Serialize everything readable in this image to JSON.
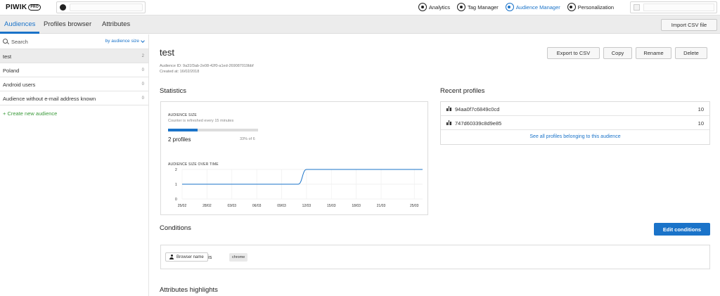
{
  "topbar": {
    "logo_text": "PIWIK",
    "logo_badge": "PRO",
    "modules": [
      {
        "label": "Analytics",
        "icon": "analytics-icon",
        "active": false
      },
      {
        "label": "Tag Manager",
        "icon": "tag-manager-icon",
        "active": false
      },
      {
        "label": "Audience Manager",
        "icon": "audience-manager-icon",
        "active": true
      },
      {
        "label": "Personalization",
        "icon": "personalization-icon",
        "active": false
      }
    ]
  },
  "subnav": {
    "tabs": [
      "Audiences",
      "Profiles browser",
      "Attributes"
    ],
    "active_tab": "Audiences",
    "import_label": "Import CSV file"
  },
  "sidebar": {
    "search_placeholder": "Search",
    "sort_label": "by audience size",
    "audiences": [
      {
        "name": "test",
        "count": "2",
        "selected": true
      },
      {
        "name": "Poland",
        "count": "0",
        "selected": false
      },
      {
        "name": "Android users",
        "count": "0",
        "selected": false
      },
      {
        "name": "Audience without e-mail address known",
        "count": "0",
        "selected": false
      }
    ],
    "create_label": "+ Create new audience"
  },
  "audience": {
    "title": "test",
    "id_line": "Audience ID: 9a31f3ab-2e08-42f0-a1ed-269087019bbf",
    "created_line": "Created at: 16/02/2018",
    "actions": [
      "Export to CSV",
      "Copy",
      "Rename",
      "Delete"
    ]
  },
  "statistics": {
    "title": "Statistics",
    "size_label": "AUDIENCE SIZE",
    "refresh_note": "Counter is refreshed every 15 minutes",
    "progress_fraction": 0.33,
    "profiles_text": "2 profiles",
    "percent_text": "33% of 6",
    "over_time_label": "AUDIENCE SIZE OVER TIME"
  },
  "chart_data": {
    "type": "line",
    "title": "AUDIENCE SIZE OVER TIME",
    "xlabel": "",
    "ylabel": "",
    "x": [
      "25/02",
      "26/02",
      "27/02",
      "28/02",
      "01/03",
      "02/03",
      "03/03",
      "04/03",
      "05/03",
      "06/03",
      "07/03",
      "08/03",
      "09/03",
      "10/03",
      "11/03",
      "12/03",
      "13/03",
      "14/03",
      "15/03",
      "16/03",
      "17/03",
      "18/03",
      "19/03",
      "20/03",
      "21/03",
      "22/03",
      "23/03",
      "24/03",
      "25/03",
      "26/03"
    ],
    "series": [
      {
        "values": [
          1,
          1,
          1,
          1,
          1,
          1,
          1,
          1,
          1,
          1,
          1,
          1,
          1,
          1,
          1,
          2,
          2,
          2,
          2,
          2,
          2,
          2,
          2,
          2,
          2,
          2,
          2,
          2,
          2,
          2
        ]
      }
    ],
    "x_tick_labels": [
      "25/02",
      "28/02",
      "03/03",
      "06/03",
      "09/03",
      "12/03",
      "15/03",
      "18/03",
      "21/03",
      "25/03"
    ],
    "y_ticks": [
      0,
      1,
      2
    ],
    "ylim": [
      0,
      2
    ],
    "grid": true,
    "color": "#1a73c9"
  },
  "recent": {
    "title": "Recent profiles",
    "profiles": [
      {
        "id": "94aa0f7c6849c0cd",
        "value": "10"
      },
      {
        "id": "747d60339c8d9e85",
        "value": "10"
      }
    ],
    "see_all": "See all profiles belonging to this audience"
  },
  "conditions": {
    "title": "Conditions",
    "edit_label": "Edit conditions",
    "attribute": "Browser name",
    "operator": "is",
    "value": "chrome"
  },
  "attributes_highlights": {
    "title": "Attributes highlights"
  },
  "colors": {
    "accent": "#1a73c9",
    "create_link": "#3a9a3a"
  }
}
